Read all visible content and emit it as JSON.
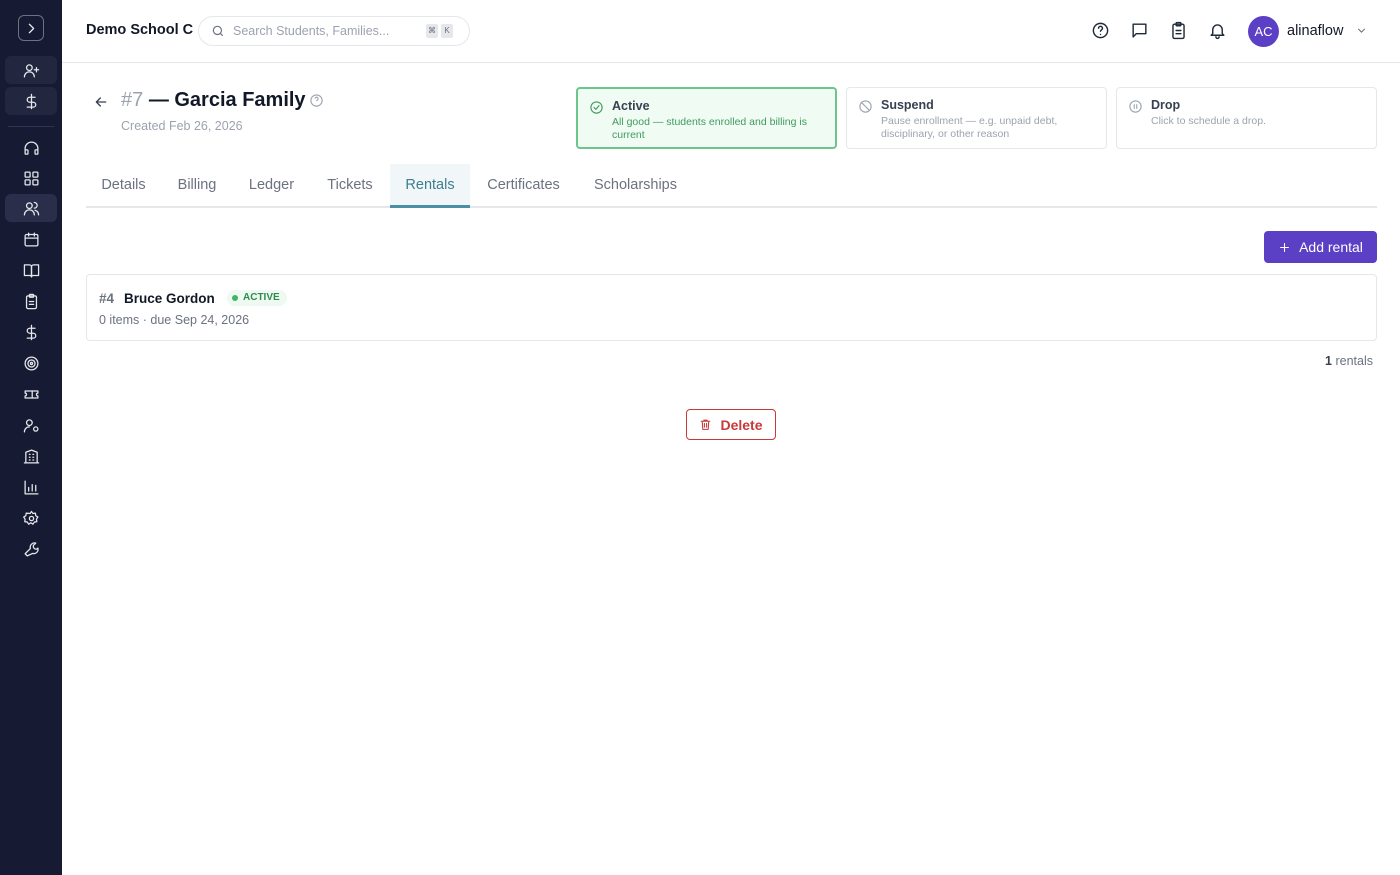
{
  "sidebar": {
    "toggle_icon": "chevron-right-icon",
    "items": [
      {
        "icon": "user-plus-icon"
      },
      {
        "icon": "dollar-icon"
      },
      {
        "icon": "headset-icon"
      },
      {
        "icon": "dashboard-icon"
      },
      {
        "icon": "users-icon",
        "active": true
      },
      {
        "icon": "calendar-icon"
      },
      {
        "icon": "book-icon"
      },
      {
        "icon": "clipboard-icon"
      },
      {
        "icon": "dollar-icon"
      },
      {
        "icon": "target-icon"
      },
      {
        "icon": "ticket-icon"
      },
      {
        "icon": "user-cog-icon"
      },
      {
        "icon": "building-icon"
      },
      {
        "icon": "bar-chart-icon"
      },
      {
        "icon": "settings-icon"
      },
      {
        "icon": "wrench-icon"
      }
    ]
  },
  "header": {
    "school_name": "Demo School C",
    "search_placeholder": "Search Students, Families...",
    "shortcut_keys": [
      "⌘",
      "K"
    ],
    "user": {
      "initials": "AC",
      "name": "alinaflow"
    }
  },
  "family": {
    "number": "#7",
    "separator": "—",
    "name": "Garcia Family",
    "created": "Created Feb 26, 2026"
  },
  "status_options": [
    {
      "title": "Active",
      "description": "All good — students enrolled and billing is current",
      "selected": true
    },
    {
      "title": "Suspend",
      "description": "Pause enrollment — e.g. unpaid debt, disciplinary, or other reason",
      "selected": false
    },
    {
      "title": "Drop",
      "description": "Click to schedule a drop.",
      "selected": false
    }
  ],
  "tabs": [
    "Details",
    "Billing",
    "Ledger",
    "Tickets",
    "Rentals",
    "Certificates",
    "Scholarships"
  ],
  "active_tab": "Rentals",
  "actions": {
    "add_rental": "Add rental",
    "delete": "Delete"
  },
  "rentals": [
    {
      "id": "#4",
      "name": "Bruce Gordon",
      "status": "ACTIVE",
      "meta": "0 items · due Sep 24, 2026"
    }
  ],
  "rental_count": {
    "value": "1",
    "label": "rentals"
  },
  "colors": {
    "sidebar_bg": "#171a33",
    "accent": "#5b3fc4",
    "active_tab": "#3d7d8f",
    "success": "#3fb56a",
    "danger": "#c73a3a"
  }
}
